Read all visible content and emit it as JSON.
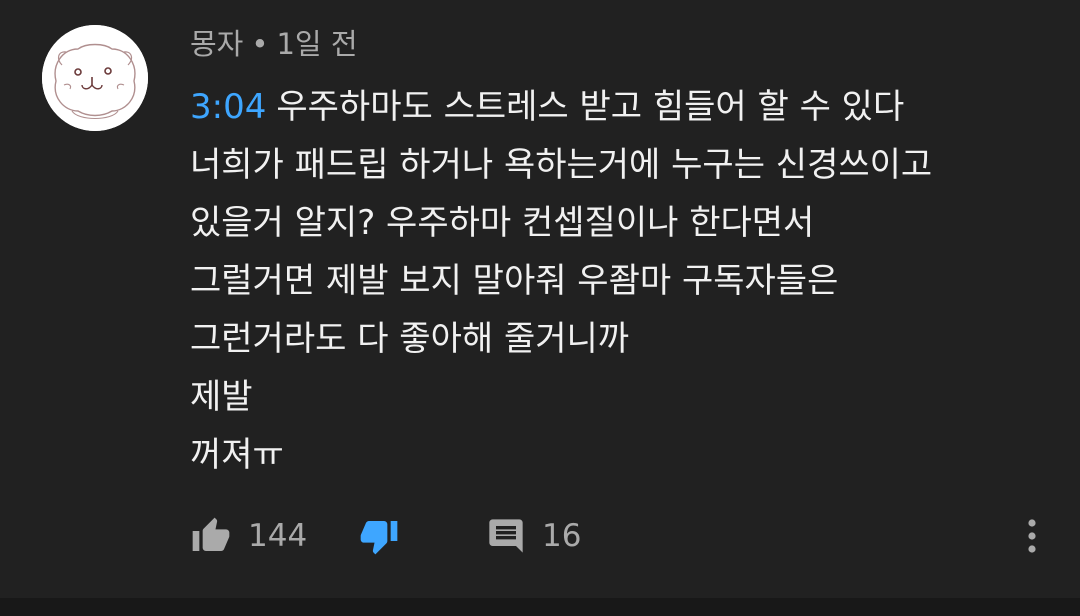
{
  "comment": {
    "author": "몽자",
    "separator": "•",
    "time_ago": "1일 전",
    "timestamp_link": "3:04",
    "lines": {
      "l1": "우주하마도 스트레스 받고 힘들어 할 수 있다",
      "l2": "너희가 패드립 하거나 욕하는거에 누구는 신경쓰이고",
      "l3": "있을거 알지? 우주하마 컨셉질이나 한다면서",
      "l4": "그럴거면 제발 보지 말아줘 우좜마 구독자들은",
      "l5": "그런거라도 다 좋아해 줄거니까",
      "l6": "제발",
      "l7": "꺼져ㅠ"
    },
    "like_count": "144",
    "reply_count": "16"
  },
  "icons": {
    "avatar": "cartoon-face-avatar",
    "like": "thumbs-up-icon",
    "dislike": "thumbs-down-icon",
    "reply": "comment-icon",
    "more": "vertical-dots-icon"
  },
  "colors": {
    "background": "#212121",
    "text": "#f1f1f1",
    "secondary": "#aaaaaa",
    "link": "#3ea6ff",
    "dislike_active": "#3ea6ff"
  }
}
